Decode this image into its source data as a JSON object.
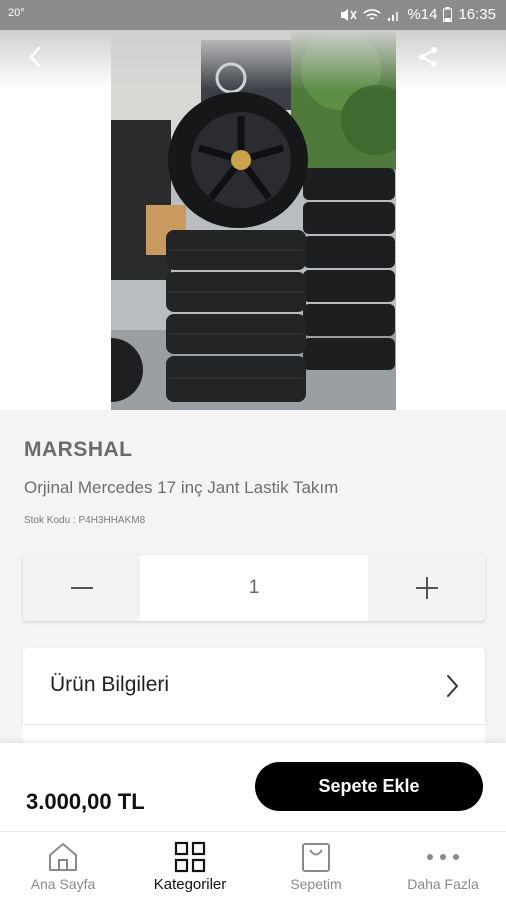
{
  "status_bar": {
    "temperature": "20°",
    "battery": "%14",
    "time": "16:35"
  },
  "header": {
    "back_icon": "chevron-left-icon",
    "share_icon": "share-icon"
  },
  "product": {
    "brand": "MARSHAL",
    "name": "Orjinal Mercedes 17 inç Jant Lastik Takım",
    "sku": "Stok Kodu : P4H3HHAKM8"
  },
  "quantity": {
    "value": "1"
  },
  "sections": {
    "info_label": "Ürün Bilgileri"
  },
  "buy": {
    "price": "3.000,00 TL",
    "add_to_cart": "Sepete Ekle"
  },
  "nav": {
    "items": [
      {
        "label": "Ana Sayfa",
        "icon": "home-icon"
      },
      {
        "label": "Kategoriler",
        "icon": "grid-icon"
      },
      {
        "label": "Sepetim",
        "icon": "cart-icon"
      },
      {
        "label": "Daha Fazla",
        "icon": "more-icon"
      }
    ],
    "active_index": 1
  }
}
